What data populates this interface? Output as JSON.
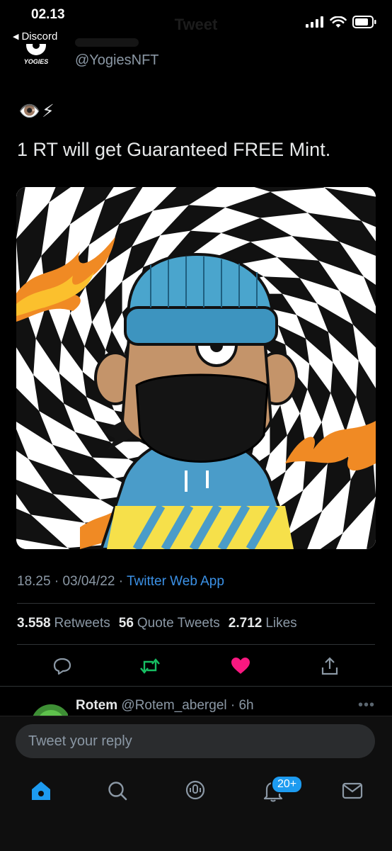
{
  "status_bar": {
    "time": "02.13",
    "back_app": "Discord"
  },
  "nav": {
    "title": "Tweet"
  },
  "account": {
    "handle": "@YogiesNFT",
    "avatar_text": "YOGIES"
  },
  "tweet": {
    "emojis": "👁️⚡",
    "text": "1 RT will get Guaranteed FREE Mint.",
    "time": "18.25",
    "date": "03/04/22",
    "source": "Twitter Web App"
  },
  "stats": {
    "retweets_count": "3.558",
    "retweets_label": "Retweets",
    "quotes_count": "56",
    "quotes_label": "Quote Tweets",
    "likes_count": "2.712",
    "likes_label": "Likes"
  },
  "reply": {
    "name": "Rotem",
    "handle_time": "@Rotem_abergel · 6h"
  },
  "composer": {
    "placeholder": "Tweet your reply"
  },
  "tabs": {
    "notifications_badge": "20+"
  },
  "colors": {
    "accent": "#1d9bf0",
    "retweet": "#17bf63",
    "like": "#f91880",
    "link": "#3b91e6"
  },
  "icons": [
    "reply-icon",
    "retweet-icon",
    "like-icon",
    "share-icon",
    "home-icon",
    "search-icon",
    "spaces-icon",
    "notifications-icon",
    "messages-icon"
  ]
}
